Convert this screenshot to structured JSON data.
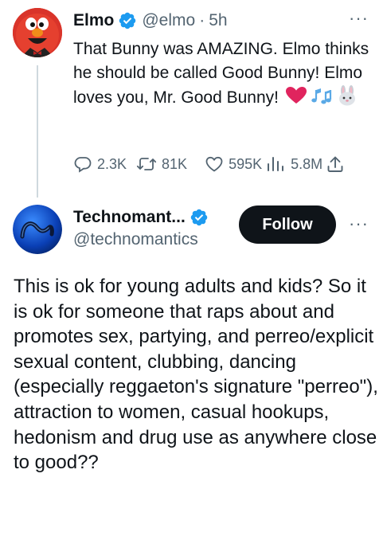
{
  "tweet1": {
    "name": "Elmo",
    "handle": "@elmo",
    "separator": "·",
    "time": "5h",
    "more_label": "···",
    "text": "That Bunny was AMAZING. Elmo thinks he should be called Good Bunny! Elmo loves you, Mr. Good Bunny!",
    "emojis": [
      "heart-emoji",
      "music-notes-emoji",
      "rabbit-emoji"
    ],
    "stats": {
      "replies": "2.3K",
      "reposts": "81K",
      "likes": "595K",
      "views": "5.8M"
    }
  },
  "tweet2": {
    "name": "Technomant...",
    "handle": "@technomantics",
    "follow_label": "Follow",
    "more_label": "···",
    "text": "This is ok for young adults and kids? So it is ok for someone that raps about and promotes sex, partying, and perreo/explicit sexual content, clubbing, dancing (especially reggaeton's signature \"perreo\"), attraction to women, casual hookups, hedonism and drug use as anywhere close to good??"
  },
  "colors": {
    "text": "#0f1419",
    "muted": "#536471",
    "verified": "#1d9bf0",
    "thread_line": "#cfd9de",
    "follow_bg": "#0f1419",
    "heart": "#e0245e"
  }
}
